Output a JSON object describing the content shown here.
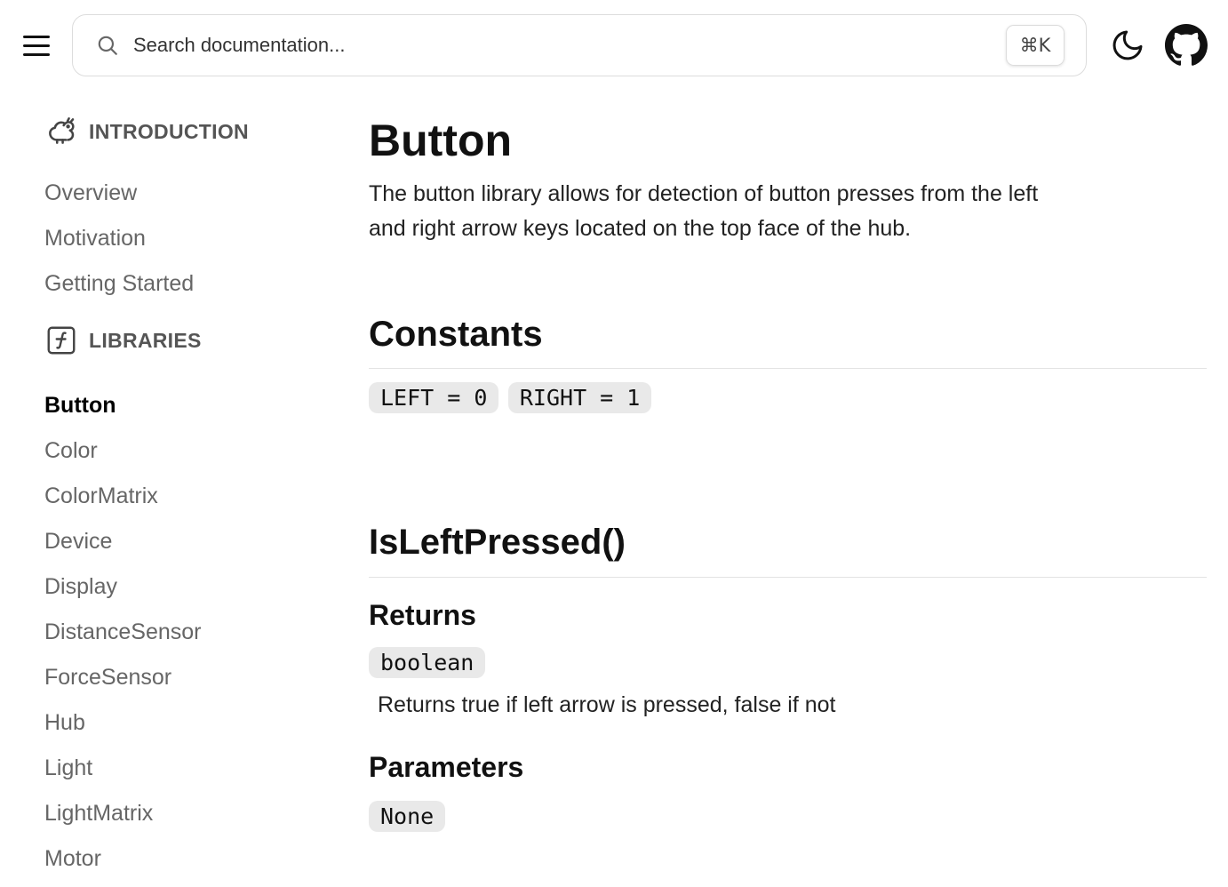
{
  "header": {
    "search_placeholder": "Search documentation...",
    "shortcut": "⌘K"
  },
  "sidebar": {
    "sections": [
      {
        "label": "INTRODUCTION",
        "icon": "squirrel-icon",
        "items": [
          "Overview",
          "Motivation",
          "Getting Started"
        ]
      },
      {
        "label": "LIBRARIES",
        "icon": "function-icon",
        "items": [
          "Button",
          "Color",
          "ColorMatrix",
          "Device",
          "Display",
          "DistanceSensor",
          "ForceSensor",
          "Hub",
          "Light",
          "LightMatrix",
          "Motor"
        ],
        "active": "Button"
      }
    ]
  },
  "main": {
    "title": "Button",
    "intro": "The button library allows for detection of button presses from the left and right arrow keys located on the top face of the hub.",
    "constants": {
      "heading": "Constants",
      "items": [
        "LEFT = 0",
        "RIGHT = 1"
      ]
    },
    "function": {
      "name": "IsLeftPressed()",
      "returns_heading": "Returns",
      "returns_type": "boolean",
      "returns_desc": "Returns true if left arrow is pressed, false if not",
      "params_heading": "Parameters",
      "params_value": "None"
    }
  }
}
